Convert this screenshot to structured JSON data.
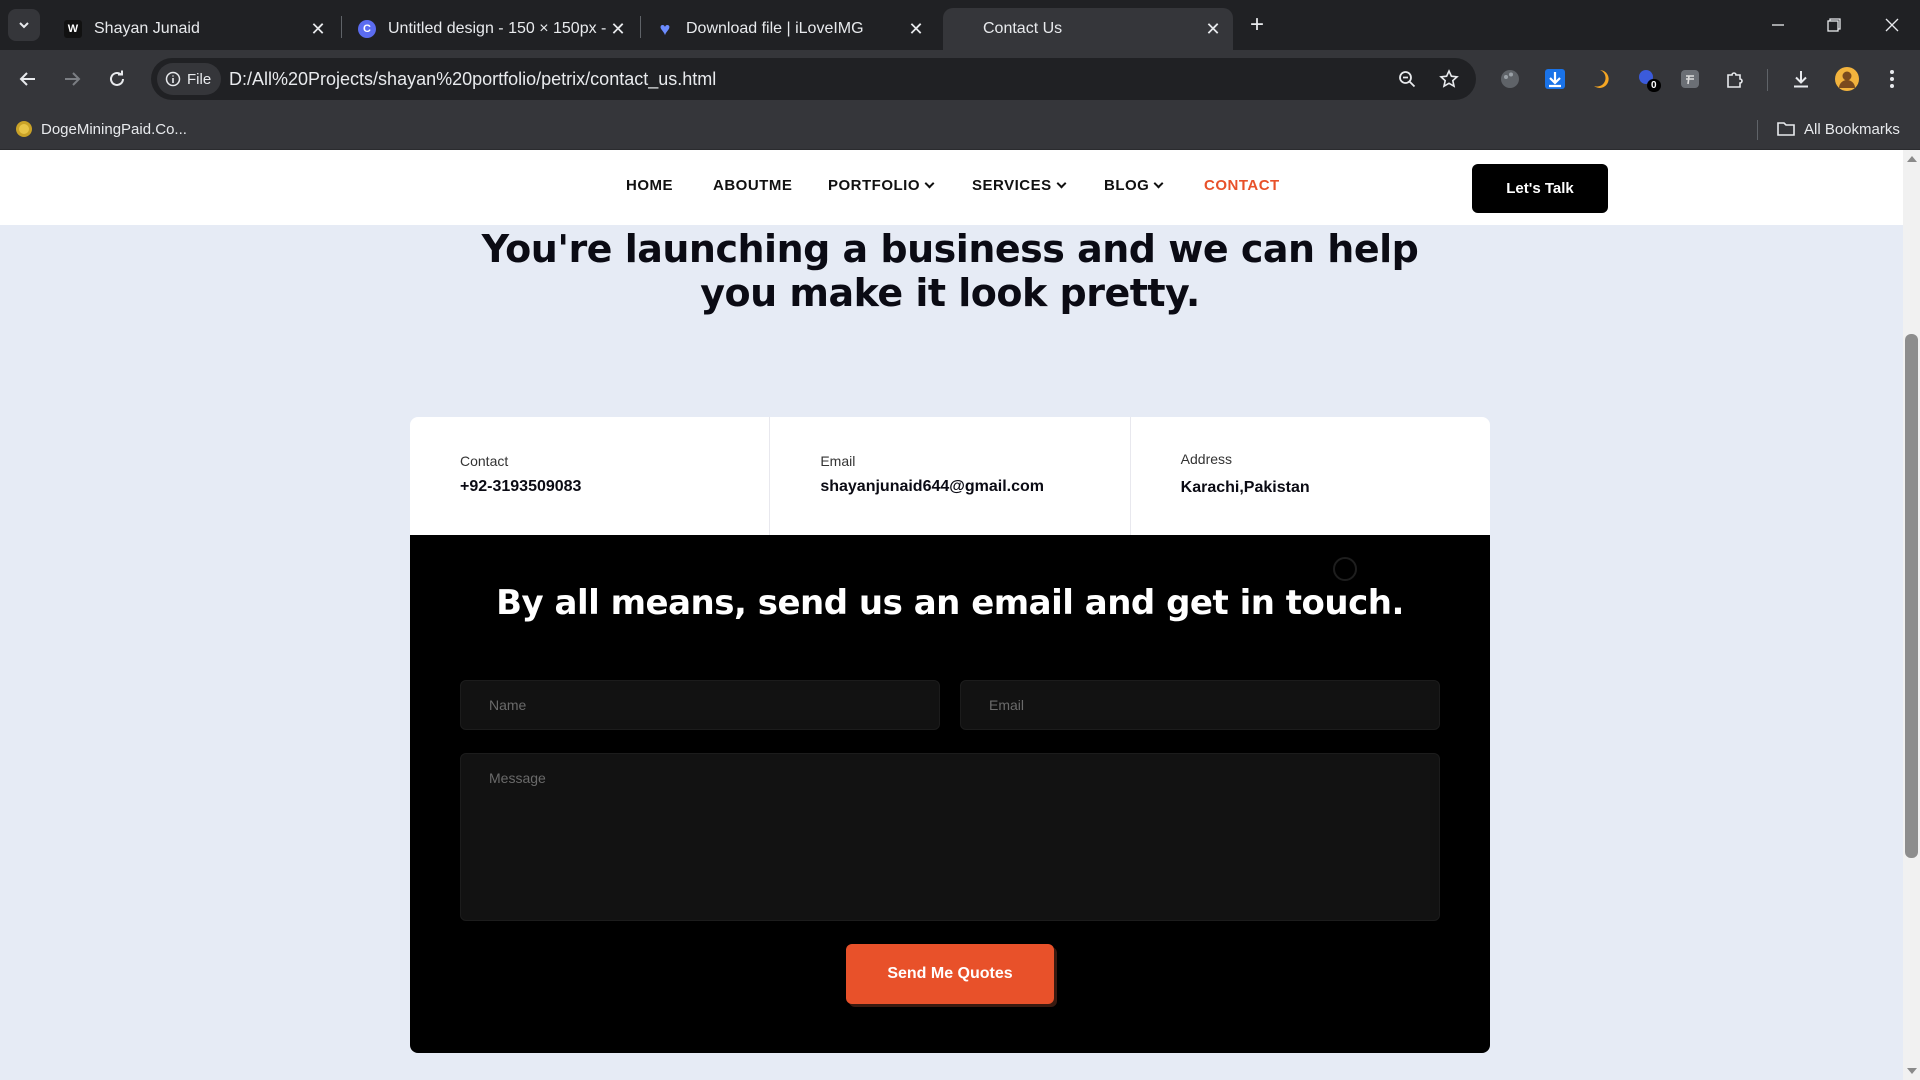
{
  "browser": {
    "tabs": [
      {
        "title": "Shayan Junaid",
        "favicon": "w-logo-icon"
      },
      {
        "title": "Untitled design - 150 × 150px -",
        "favicon": "canva-icon"
      },
      {
        "title": "Download file | iLoveIMG",
        "favicon": "heart-icon"
      },
      {
        "title": "Contact Us",
        "favicon": "none",
        "active": true
      }
    ],
    "address": {
      "chip_label": "File",
      "url": "D:/All%20Projects/shayan%20portfolio/petrix/contact_us.html"
    },
    "extension_badge": "0",
    "bookmarks": {
      "item": "DogeMiningPaid.Co...",
      "all_label": "All Bookmarks"
    }
  },
  "site": {
    "nav": {
      "home": "HOME",
      "about": "ABOUTME",
      "portfolio": "PORTFOLIO",
      "services": "SERVICES",
      "blog": "BLOG",
      "contact": "CONTACT",
      "cta": "Let's Talk"
    },
    "hero": {
      "line1": "You're launching a business and we can help",
      "line2": "you make it look pretty."
    },
    "info": {
      "contact_label": "Contact",
      "contact_value": "+92-3193509083",
      "email_label": "Email",
      "email_value": "shayanjunaid644@gmail.com",
      "address_label": "Address",
      "address_value": "Karachi,Pakistan"
    },
    "form": {
      "title": "By all means, send us an email and get in touch.",
      "name_placeholder": "Name",
      "email_placeholder": "Email",
      "message_placeholder": "Message",
      "submit_label": "Send Me Quotes"
    }
  },
  "colors": {
    "accent": "#e8512a",
    "page_bg": "#e6ebf5",
    "form_bg": "#000000"
  }
}
